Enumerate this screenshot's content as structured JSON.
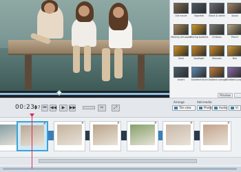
{
  "player": {
    "time_main": "00:23",
    "time_frac": "87",
    "scrub_position": 0.35
  },
  "effects": {
    "items": [
      {
        "label": "Old movie",
        "color": "#7e6a4d"
      },
      {
        "label": "Vignette",
        "color": "#4d5963"
      },
      {
        "label": "Black & white",
        "color": "#6d6d6d"
      },
      {
        "label": "Sepia",
        "color": "#a4846a"
      },
      {
        "label": "Moving old paper",
        "color": "#a88756"
      },
      {
        "label": "Moving bubbles",
        "color": "#d39a27"
      },
      {
        "label": "Emboss",
        "color": "#7d7a70"
      },
      {
        "label": "Pencil",
        "color": "#b9a57f"
      },
      {
        "label": "Swirl",
        "color": "#d7941f"
      },
      {
        "label": "Spotlight",
        "color": "#c8892a"
      },
      {
        "label": "Sharpen",
        "color": "#cf8d26"
      },
      {
        "label": "Blur",
        "color": "#d59a32"
      },
      {
        "label": "Invert",
        "color": "#4c5f6d"
      },
      {
        "label": "Gradient blue",
        "color": "#5f8ab1"
      },
      {
        "label": "Gradient orange",
        "color": "#c67b38"
      },
      {
        "label": "Gradient purple",
        "color": "#8c6aa8"
      }
    ],
    "preview_label": "Preview"
  },
  "toolbar": {
    "arrange_label": "Arrange",
    "add_media_label": "Add media",
    "tile_view_label": "Tile view",
    "photos_label": "Photos",
    "audio_label": "Audio",
    "more_label": "Vi"
  },
  "colors": {
    "selection": "#3aa3d6",
    "playhead": "#e0245e",
    "transition_dark": "#2b3a4a",
    "transition_blue": "#3a7fb8"
  }
}
